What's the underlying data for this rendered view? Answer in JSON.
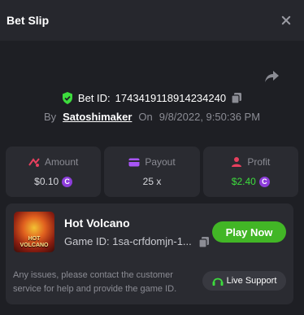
{
  "header": {
    "title": "Bet Slip"
  },
  "bet": {
    "id_label": "Bet ID:",
    "id": "1743419118914234240",
    "by_label": "By",
    "username": "Satoshimaker",
    "on_label": "On",
    "datetime": "9/8/2022, 9:50:36 PM"
  },
  "stats": {
    "amount": {
      "label": "Amount",
      "value": "$0.10",
      "coin": "C"
    },
    "payout": {
      "label": "Payout",
      "value": "25 x"
    },
    "profit": {
      "label": "Profit",
      "value": "$2.40",
      "coin": "C"
    }
  },
  "game": {
    "thumb_text_1": "HOT",
    "thumb_text_2": "VOLCANO",
    "name": "Hot Volcano",
    "id_text": "Game ID: 1sa-crfdomjn-1...",
    "play_label": "Play Now",
    "note": "Any issues, please contact the customer service for help and provide the game ID.",
    "support_label": "Live Support"
  },
  "colors": {
    "accent_green": "#42b626",
    "profit_green": "#3ddc3d",
    "coin_purple": "#8d3ddb"
  }
}
